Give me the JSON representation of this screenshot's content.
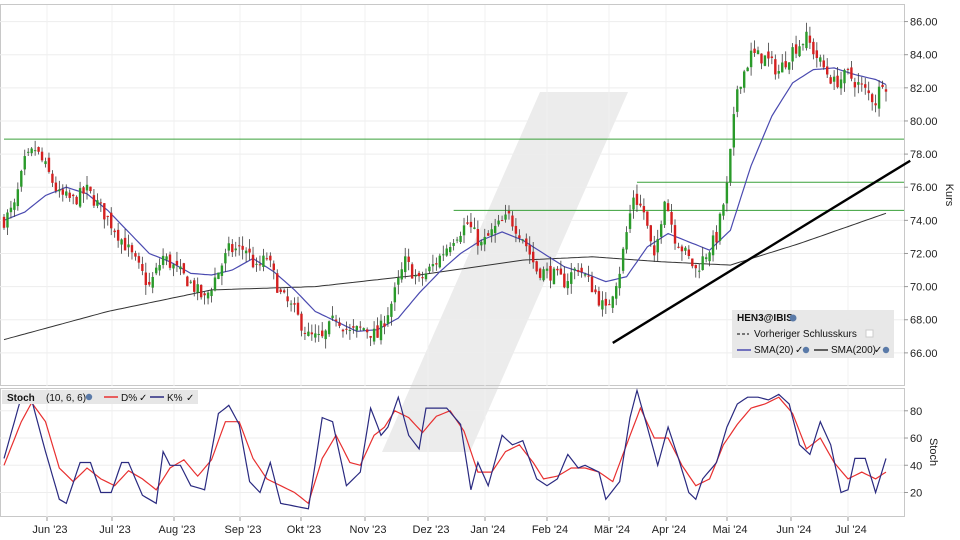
{
  "chart_data": [
    {
      "type": "candlestick",
      "symbol": "HEN3@IBIS",
      "ylabel": "Kurs",
      "ylim": [
        64.0,
        87.0
      ],
      "y_ticks": [
        "66.00",
        "68.00",
        "70.00",
        "72.00",
        "74.00",
        "76.00",
        "78.00",
        "80.00",
        "82.00",
        "84.00",
        "86.00"
      ],
      "y_tick_values": [
        66,
        68,
        70,
        72,
        74,
        76,
        78,
        80,
        82,
        84,
        86
      ],
      "x_ticks": [
        "Jun '23",
        "Jul '23",
        "Aug '23",
        "Sep '23",
        "Okt '23",
        "Nov '23",
        "Dez '23",
        "Jan '24",
        "Feb '24",
        "Mär '24",
        "Apr '24",
        "Mai '24",
        "Jun '24",
        "Jul '24"
      ],
      "legend": {
        "title": "HEN3@IBIS",
        "items": [
          "Vorheriger Schlusskurs",
          "SMA(20)",
          "SMA(200)"
        ]
      },
      "colors": {
        "up": "#2a9a2a",
        "down": "#d42020",
        "sma20": "#4a4ab0",
        "sma200": "#333333",
        "hline": "#3aa03a",
        "trend": "#000000"
      },
      "close_anchors": [
        [
          0,
          74.0
        ],
        [
          3,
          74.8
        ],
        [
          6,
          77.5
        ],
        [
          9,
          78.3
        ],
        [
          12,
          77.2
        ],
        [
          16,
          75.5
        ],
        [
          20,
          75.2
        ],
        [
          24,
          75.8
        ],
        [
          27,
          75.0
        ],
        [
          32,
          73.5
        ],
        [
          36,
          72.2
        ],
        [
          42,
          70.0
        ],
        [
          46,
          71.8
        ],
        [
          50,
          71.0
        ],
        [
          54,
          70.2
        ],
        [
          58,
          69.2
        ],
        [
          61,
          70.5
        ],
        [
          65,
          72.2
        ],
        [
          70,
          72.3
        ],
        [
          73,
          71.0
        ],
        [
          76,
          71.8
        ],
        [
          80,
          69.5
        ],
        [
          84,
          68.5
        ],
        [
          88,
          67.0
        ],
        [
          92,
          66.8
        ],
        [
          96,
          68.2
        ],
        [
          100,
          67.2
        ],
        [
          104,
          67.5
        ],
        [
          108,
          67.0
        ],
        [
          112,
          69.0
        ],
        [
          116,
          71.5
        ],
        [
          120,
          70.3
        ],
        [
          125,
          71.5
        ],
        [
          130,
          73.0
        ],
        [
          134,
          73.8
        ],
        [
          138,
          72.5
        ],
        [
          142,
          73.5
        ],
        [
          146,
          74.2
        ],
        [
          150,
          73.0
        ],
        [
          154,
          71.0
        ],
        [
          158,
          70.8
        ],
        [
          162,
          70.3
        ],
        [
          166,
          71.2
        ],
        [
          170,
          70.0
        ],
        [
          174,
          68.5
        ],
        [
          178,
          71.0
        ],
        [
          182,
          75.5
        ],
        [
          185,
          74.5
        ],
        [
          188,
          71.5
        ],
        [
          191,
          75.5
        ],
        [
          194,
          73.0
        ],
        [
          197,
          72.0
        ],
        [
          200,
          71.0
        ],
        [
          203,
          72.0
        ],
        [
          206,
          73.0
        ],
        [
          209,
          76.0
        ],
        [
          212,
          82.0
        ],
        [
          216,
          84.0
        ],
        [
          220,
          83.8
        ],
        [
          224,
          83.0
        ],
        [
          228,
          84.3
        ],
        [
          232,
          85.0
        ],
        [
          236,
          83.5
        ],
        [
          240,
          82.3
        ],
        [
          244,
          82.8
        ],
        [
          248,
          82.0
        ],
        [
          252,
          81.2
        ],
        [
          254,
          82.5
        ],
        [
          255,
          82.2
        ]
      ],
      "sma20_anchors": [
        [
          0,
          74.0
        ],
        [
          6,
          74.5
        ],
        [
          12,
          75.5
        ],
        [
          18,
          76.0
        ],
        [
          24,
          75.6
        ],
        [
          30,
          74.6
        ],
        [
          36,
          73.3
        ],
        [
          42,
          72.0
        ],
        [
          48,
          71.5
        ],
        [
          54,
          70.8
        ],
        [
          60,
          70.7
        ],
        [
          66,
          71.0
        ],
        [
          72,
          71.7
        ],
        [
          78,
          70.9
        ],
        [
          84,
          69.8
        ],
        [
          90,
          68.5
        ],
        [
          96,
          67.9
        ],
        [
          102,
          67.3
        ],
        [
          108,
          67.4
        ],
        [
          114,
          68.1
        ],
        [
          120,
          69.6
        ],
        [
          126,
          70.9
        ],
        [
          132,
          72.0
        ],
        [
          138,
          72.8
        ],
        [
          144,
          73.3
        ],
        [
          150,
          72.8
        ],
        [
          156,
          72.0
        ],
        [
          162,
          71.2
        ],
        [
          168,
          70.8
        ],
        [
          174,
          70.3
        ],
        [
          180,
          70.6
        ],
        [
          186,
          72.4
        ],
        [
          192,
          73.2
        ],
        [
          198,
          72.7
        ],
        [
          204,
          72.2
        ],
        [
          210,
          73.4
        ],
        [
          216,
          77.3
        ],
        [
          222,
          80.3
        ],
        [
          228,
          82.3
        ],
        [
          234,
          83.1
        ],
        [
          240,
          83.2
        ],
        [
          246,
          82.8
        ],
        [
          252,
          82.5
        ],
        [
          255,
          82.2
        ]
      ],
      "sma200_anchors": [
        [
          0,
          66.8
        ],
        [
          30,
          68.5
        ],
        [
          60,
          69.8
        ],
        [
          90,
          70.0
        ],
        [
          120,
          70.7
        ],
        [
          150,
          71.6
        ],
        [
          170,
          71.8
        ],
        [
          190,
          71.5
        ],
        [
          210,
          71.3
        ],
        [
          230,
          72.6
        ],
        [
          256,
          74.5
        ]
      ],
      "horizontal_levels": [
        {
          "value": 78.9,
          "from_x": 0
        },
        {
          "value": 76.3,
          "from_x": 183
        },
        {
          "value": 74.6,
          "from_x": 130
        }
      ],
      "trendline": {
        "x0": 176,
        "y0": 66.6,
        "x1": 262,
        "y1": 77.6
      }
    },
    {
      "type": "line",
      "indicator": "Stoch",
      "params": "(10, 6, 6)",
      "ylabel": "Stoch",
      "ylim": [
        2,
        96
      ],
      "y_ticks": [
        "20",
        "40",
        "60",
        "80"
      ],
      "y_tick_values": [
        20,
        40,
        60,
        80
      ],
      "legend": {
        "title": "Stoch",
        "params": "(10, 6, 6)",
        "d_label": "D%",
        "k_label": "K%"
      },
      "series": [
        {
          "name": "K%",
          "color": "#2a2a80",
          "anchors": [
            [
              0,
              45
            ],
            [
              5,
              90
            ],
            [
              8,
              88
            ],
            [
              12,
              50
            ],
            [
              16,
              15
            ],
            [
              18,
              12
            ],
            [
              22,
              42
            ],
            [
              25,
              42
            ],
            [
              28,
              20
            ],
            [
              31,
              20
            ],
            [
              34,
              42
            ],
            [
              36,
              42
            ],
            [
              40,
              18
            ],
            [
              44,
              12
            ],
            [
              46,
              50
            ],
            [
              48,
              40
            ],
            [
              51,
              40
            ],
            [
              54,
              25
            ],
            [
              58,
              22
            ],
            [
              62,
              78
            ],
            [
              65,
              84
            ],
            [
              68,
              70
            ],
            [
              71,
              28
            ],
            [
              74,
              20
            ],
            [
              77,
              42
            ],
            [
              80,
              12
            ],
            [
              84,
              10
            ],
            [
              88,
              8
            ],
            [
              92,
              75
            ],
            [
              95,
              72
            ],
            [
              99,
              25
            ],
            [
              103,
              35
            ],
            [
              106,
              82
            ],
            [
              109,
              62
            ],
            [
              111,
              68
            ],
            [
              114,
              90
            ],
            [
              117,
              62
            ],
            [
              120,
              52
            ],
            [
              122,
              82
            ],
            [
              124,
              82
            ],
            [
              128,
              82
            ],
            [
              132,
              70
            ],
            [
              135,
              22
            ],
            [
              137,
              42
            ],
            [
              140,
              25
            ],
            [
              144,
              62
            ],
            [
              147,
              55
            ],
            [
              150,
              58
            ],
            [
              154,
              30
            ],
            [
              157,
              25
            ],
            [
              160,
              30
            ],
            [
              163,
              48
            ],
            [
              166,
              38
            ],
            [
              168,
              40
            ],
            [
              172,
              35
            ],
            [
              174,
              15
            ],
            [
              178,
              28
            ],
            [
              181,
              75
            ],
            [
              183,
              95
            ],
            [
              186,
              68
            ],
            [
              189,
              40
            ],
            [
              192,
              68
            ],
            [
              195,
              45
            ],
            [
              198,
              20
            ],
            [
              200,
              15
            ],
            [
              202,
              30
            ],
            [
              206,
              42
            ],
            [
              209,
              68
            ],
            [
              212,
              85
            ],
            [
              215,
              90
            ],
            [
              218,
              90
            ],
            [
              221,
              88
            ],
            [
              224,
              92
            ],
            [
              227,
              85
            ],
            [
              230,
              55
            ],
            [
              233,
              48
            ],
            [
              236,
              72
            ],
            [
              239,
              55
            ],
            [
              242,
              20
            ],
            [
              244,
              22
            ],
            [
              246,
              45
            ],
            [
              249,
              45
            ],
            [
              252,
              20
            ],
            [
              255,
              45
            ]
          ]
        },
        {
          "name": "D%",
          "color": "#e83030",
          "anchors": [
            [
              0,
              40
            ],
            [
              5,
              72
            ],
            [
              8,
              86
            ],
            [
              12,
              72
            ],
            [
              16,
              38
            ],
            [
              20,
              28
            ],
            [
              24,
              38
            ],
            [
              28,
              30
            ],
            [
              32,
              25
            ],
            [
              36,
              36
            ],
            [
              40,
              30
            ],
            [
              44,
              22
            ],
            [
              48,
              38
            ],
            [
              52,
              44
            ],
            [
              56,
              32
            ],
            [
              60,
              44
            ],
            [
              64,
              72
            ],
            [
              68,
              72
            ],
            [
              72,
              45
            ],
            [
              76,
              30
            ],
            [
              80,
              25
            ],
            [
              84,
              20
            ],
            [
              88,
              12
            ],
            [
              92,
              45
            ],
            [
              96,
              62
            ],
            [
              100,
              42
            ],
            [
              103,
              40
            ],
            [
              107,
              62
            ],
            [
              110,
              68
            ],
            [
              113,
              80
            ],
            [
              117,
              75
            ],
            [
              121,
              64
            ],
            [
              125,
              76
            ],
            [
              129,
              80
            ],
            [
              133,
              65
            ],
            [
              137,
              35
            ],
            [
              141,
              35
            ],
            [
              145,
              50
            ],
            [
              149,
              55
            ],
            [
              153,
              42
            ],
            [
              156,
              30
            ],
            [
              160,
              32
            ],
            [
              164,
              38
            ],
            [
              168,
              38
            ],
            [
              172,
              35
            ],
            [
              176,
              28
            ],
            [
              180,
              55
            ],
            [
              184,
              82
            ],
            [
              188,
              60
            ],
            [
              192,
              60
            ],
            [
              196,
              40
            ],
            [
              200,
              25
            ],
            [
              204,
              30
            ],
            [
              208,
              55
            ],
            [
              212,
              70
            ],
            [
              216,
              82
            ],
            [
              220,
              85
            ],
            [
              224,
              90
            ],
            [
              228,
              78
            ],
            [
              232,
              52
            ],
            [
              236,
              60
            ],
            [
              240,
              42
            ],
            [
              244,
              30
            ],
            [
              248,
              35
            ],
            [
              252,
              30
            ],
            [
              255,
              35
            ]
          ]
        }
      ]
    }
  ]
}
